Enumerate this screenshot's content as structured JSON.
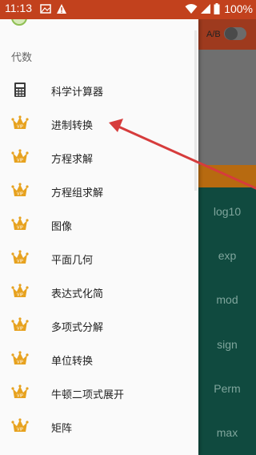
{
  "status_bar": {
    "time": "11:13",
    "battery": "100%"
  },
  "background_app": {
    "ab_label": "A/B",
    "keys": [
      "log10",
      "exp",
      "mod",
      "sign",
      "Perm",
      "max"
    ]
  },
  "drawer": {
    "section_title": "代数",
    "items": [
      {
        "label": "科学计算器",
        "icon": "calculator-icon"
      },
      {
        "label": "进制转换",
        "icon": "vip-crown-icon"
      },
      {
        "label": "方程求解",
        "icon": "vip-crown-icon"
      },
      {
        "label": "方程组求解",
        "icon": "vip-crown-icon"
      },
      {
        "label": "图像",
        "icon": "vip-crown-icon"
      },
      {
        "label": "平面几何",
        "icon": "vip-crown-icon"
      },
      {
        "label": "表达式化简",
        "icon": "vip-crown-icon"
      },
      {
        "label": "多项式分解",
        "icon": "vip-crown-icon"
      },
      {
        "label": "单位转换",
        "icon": "vip-crown-icon"
      },
      {
        "label": "牛顿二项式展开",
        "icon": "vip-crown-icon"
      },
      {
        "label": "矩阵",
        "icon": "vip-crown-icon"
      }
    ]
  },
  "colors": {
    "status_bar": "#c2411d",
    "crown": "#e7a21f",
    "annotation_arrow": "#d63c3c",
    "teal_keypad": "#104a3f"
  }
}
